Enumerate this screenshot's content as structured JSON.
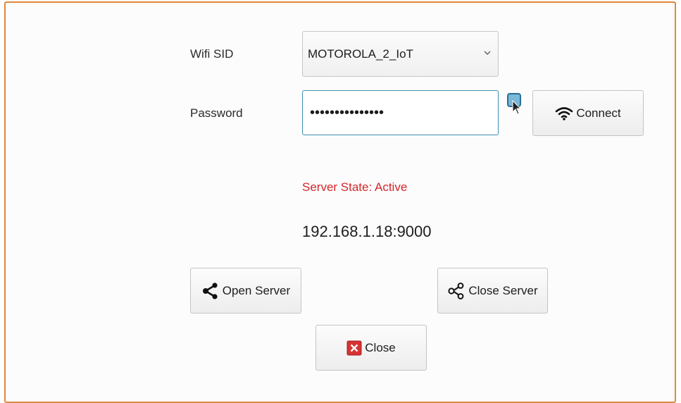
{
  "form": {
    "wifi_label": "Wifi SID",
    "wifi_value": "MOTOROLA_2_IoT",
    "password_label": "Password",
    "password_value": "•••••••••••••••",
    "connect_label": "Connect"
  },
  "server": {
    "state_text": "Server State: Active",
    "address": "192.168.1.18:9000",
    "open_label": "Open Server",
    "close_label": "Close Server"
  },
  "footer": {
    "close_label": "Close"
  },
  "colors": {
    "frame_border": "#e0883e",
    "status_red": "#d4262b",
    "focus_blue": "#3e8fb0",
    "close_icon_red": "#d63333"
  },
  "icons": {
    "combo": "chevron-down-icon",
    "connect": "wifi-icon",
    "open_server": "share-icon",
    "close_server": "share-outline-icon",
    "close": "close-x-icon"
  }
}
